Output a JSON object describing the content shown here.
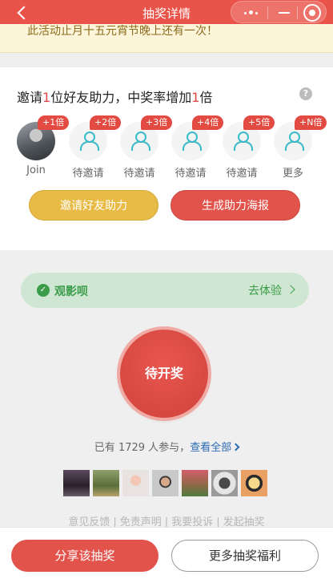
{
  "header": {
    "title": "抽奖详情"
  },
  "notice": {
    "text": "此活动止月十五元宵节晚上还有一次！"
  },
  "invite": {
    "title_prefix": "邀请",
    "title_count": "1",
    "title_mid": "位好友助力，中奖率增加",
    "title_mult": "1",
    "title_suffix": "倍",
    "help_icon": "?",
    "slots": [
      {
        "badge": "+1倍",
        "label": "Join"
      },
      {
        "badge": "+2倍",
        "label": "待邀请"
      },
      {
        "badge": "+3倍",
        "label": "待邀请"
      },
      {
        "badge": "+4倍",
        "label": "待邀请"
      },
      {
        "badge": "+5倍",
        "label": "待邀请"
      },
      {
        "badge": "+N倍",
        "label": "更多"
      }
    ],
    "invite_button": "邀请好友助力",
    "poster_button": "生成助力海报"
  },
  "promo": {
    "icon": "✓",
    "name": "观影呗",
    "action": "去体验"
  },
  "draw": {
    "label": "待开奖"
  },
  "participants": {
    "prefix": "已有",
    "count": "1729",
    "suffix": "人参与，",
    "link": "查看全部"
  },
  "footer": {
    "links": [
      "意见反馈",
      "免责声明",
      "我要投诉",
      "发起抽奖"
    ],
    "separator": "|"
  },
  "bottom": {
    "share": "分享该抽奖",
    "more": "更多抽奖福利"
  },
  "colors": {
    "brand_red": "#e9534a",
    "gold": "#e8bb47",
    "promo_green": "#3a9c48",
    "accent_teal": "#39bcc8"
  }
}
